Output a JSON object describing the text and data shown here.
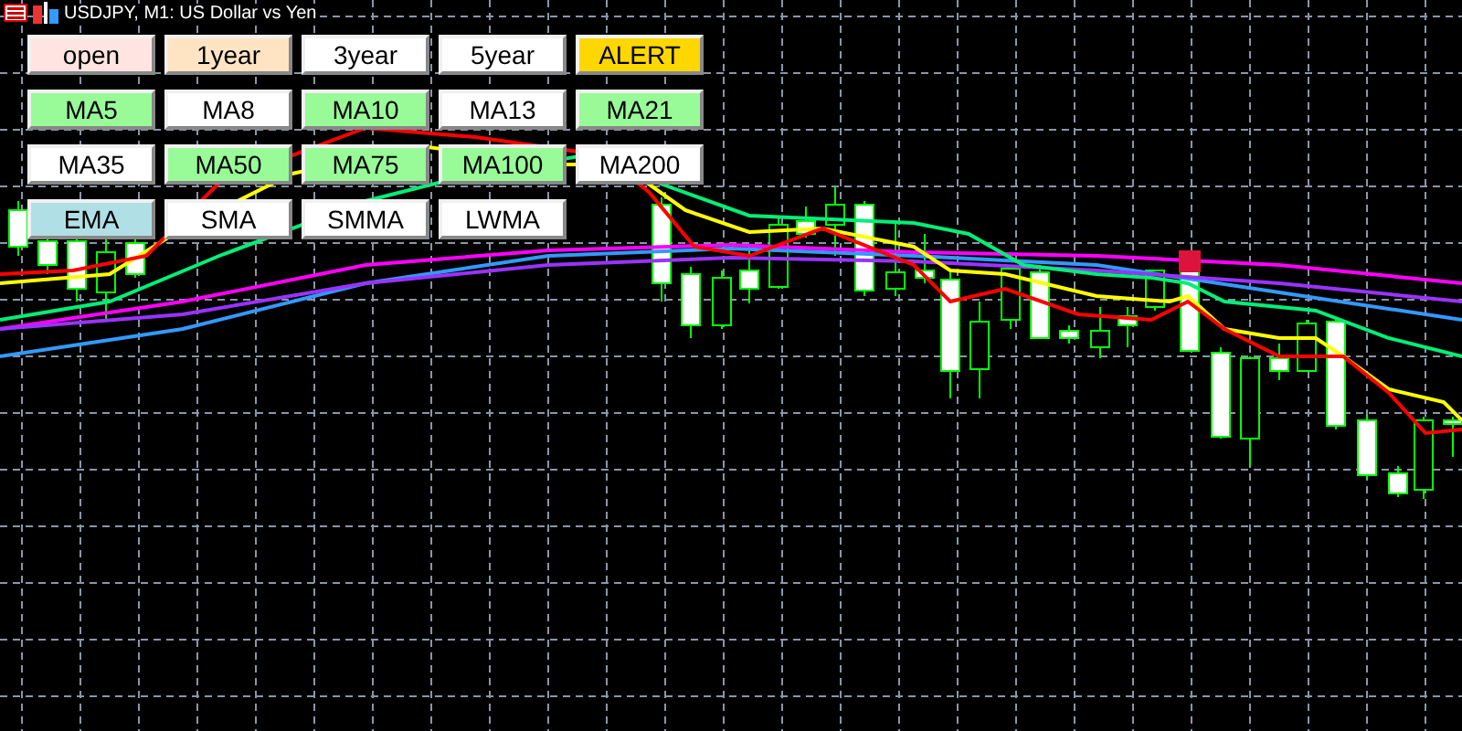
{
  "window": {
    "title": "USDJPY, M1:  US Dollar vs Yen"
  },
  "button_rows": [
    [
      {
        "label": "open",
        "kind": "period",
        "color": "#ffe4e1"
      },
      {
        "label": "1year",
        "kind": "period",
        "color": "#ffe4c4"
      },
      {
        "label": "3year",
        "kind": "period",
        "color": "#ffffff"
      },
      {
        "label": "5year",
        "kind": "period",
        "color": "#ffffff"
      },
      {
        "label": "ALERT",
        "kind": "period",
        "color": "#ffd700"
      }
    ],
    [
      {
        "label": "MA5",
        "kind": "ma",
        "selected": true
      },
      {
        "label": "MA8",
        "kind": "ma",
        "selected": false
      },
      {
        "label": "MA10",
        "kind": "ma",
        "selected": true
      },
      {
        "label": "MA13",
        "kind": "ma",
        "selected": false
      },
      {
        "label": "MA21",
        "kind": "ma",
        "selected": true
      }
    ],
    [
      {
        "label": "MA35",
        "kind": "ma",
        "selected": false
      },
      {
        "label": "MA50",
        "kind": "ma",
        "selected": true
      },
      {
        "label": "MA75",
        "kind": "ma",
        "selected": true
      },
      {
        "label": "MA100",
        "kind": "ma",
        "selected": true
      },
      {
        "label": "MA200",
        "kind": "ma",
        "selected": false
      }
    ],
    [
      {
        "label": "EMA",
        "kind": "method",
        "selected": true
      },
      {
        "label": "SMA",
        "kind": "method",
        "selected": false
      },
      {
        "label": "SMMA",
        "kind": "method",
        "selected": false
      },
      {
        "label": "LWMA",
        "kind": "method",
        "selected": false
      }
    ]
  ]
}
